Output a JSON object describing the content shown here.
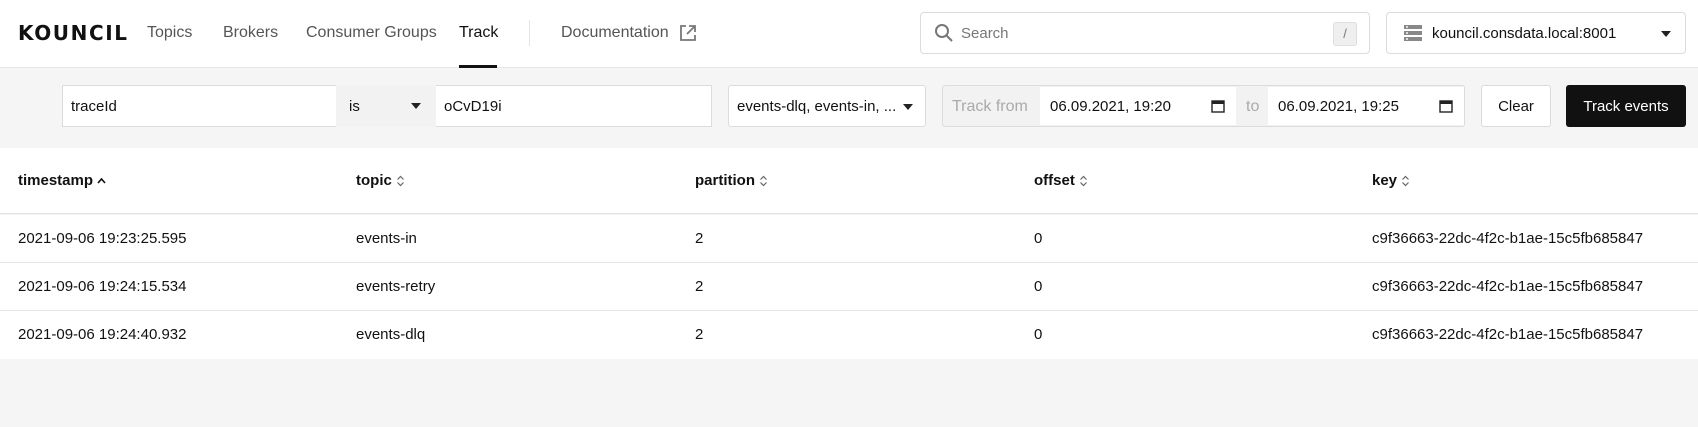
{
  "app": {
    "logo": "KOUNCIL"
  },
  "nav": {
    "topics": "Topics",
    "brokers": "Brokers",
    "consumer_groups": "Consumer Groups",
    "track": "Track",
    "documentation": "Documentation",
    "active": "Track"
  },
  "search": {
    "placeholder": "Search",
    "shortcut": "/"
  },
  "cluster": {
    "selected": "kouncil.consdata.local:8001"
  },
  "filter": {
    "field_value": "traceId",
    "operator": "is",
    "value": "oCvD19i",
    "topics": "events-dlq, events-in, ...",
    "track_from_label": "Track from",
    "from": "06.09.2021, 19:20",
    "to_label": "to",
    "to": "06.09.2021, 19:25",
    "clear_label": "Clear",
    "track_label": "Track events"
  },
  "table": {
    "columns": [
      "timestamp",
      "topic",
      "partition",
      "offset",
      "key"
    ],
    "sort": {
      "column": "timestamp",
      "direction": "asc"
    },
    "rows": [
      {
        "timestamp": "2021-09-06 19:23:25.595",
        "topic": "events-in",
        "partition": "2",
        "offset": "0",
        "key": "c9f36663-22dc-4f2c-b1ae-15c5fb685847"
      },
      {
        "timestamp": "2021-09-06 19:24:15.534",
        "topic": "events-retry",
        "partition": "2",
        "offset": "0",
        "key": "c9f36663-22dc-4f2c-b1ae-15c5fb685847"
      },
      {
        "timestamp": "2021-09-06 19:24:40.932",
        "topic": "events-dlq",
        "partition": "2",
        "offset": "0",
        "key": "c9f36663-22dc-4f2c-b1ae-15c5fb685847"
      }
    ]
  },
  "icons": {
    "search": "search-icon",
    "external_link": "external-link-icon",
    "server": "server-icon",
    "calendar": "calendar-icon",
    "sort_asc": "sort-asc-icon",
    "sort_both": "sort-icon"
  },
  "colors": {
    "primary_button": "#111111",
    "background": "#f5f5f5",
    "active_underline": "#111111"
  }
}
